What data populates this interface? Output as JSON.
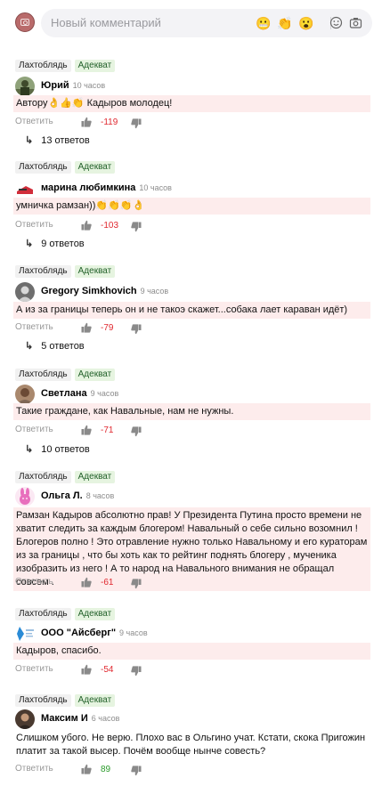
{
  "input": {
    "placeholder": "Новый комментарий",
    "emojis": [
      "😬",
      "👏",
      "😮"
    ]
  },
  "actions": {
    "reply_label": "Ответить"
  },
  "comments": [
    {
      "tag1": "Лахтоблядь",
      "tag2": "Адекват",
      "author": "Юрий",
      "time": "10 часов",
      "text": "Автору👌👍👏 Кадыров молодец!",
      "score": "-119",
      "replies": "13 ответов"
    },
    {
      "tag1": "Лахтоблядь",
      "tag2": "Адекват",
      "author": "марина любимкина",
      "time": "10 часов",
      "text": "умничка рамзан))👏👏👏👌",
      "score": "-103",
      "replies": "9 ответов"
    },
    {
      "tag1": "Лахтоблядь",
      "tag2": "Адекват",
      "author": "Gregory Simkhovich",
      "time": "9 часов",
      "text": "А из за границы теперь он и не такоэ скажет...собака лает караван идёт)",
      "score": "-79",
      "replies": "5 ответов"
    },
    {
      "tag1": "Лахтоблядь",
      "tag2": "Адекват",
      "author": "Светлана",
      "time": "9 часов",
      "text": "Такие граждане, как Навальные, нам не нужны.",
      "score": "-71",
      "replies": "10 ответов"
    },
    {
      "tag1": "Лахтоблядь",
      "tag2": "Адекват",
      "author": "Ольга Л.",
      "time": "8 часов",
      "text": "Рамзан Кадыров абсолютно прав! У Президента Путина просто времени не хватит следить за каждым блогером! Навальный о себе сильно возомнил ! Блогеров полно ! Это отравление нужно только Навальному и его кураторам из за границы , что бы хоть как то рейтинг поднять блогеру , мученика изобразить из него ! А то народ на Навального внимания не обращал совсем .",
      "score": "-61"
    },
    {
      "tag1": "Лахтоблядь",
      "tag2": "Адекват",
      "author": "ООО \"Айсберг\"",
      "time": "9 часов",
      "text": "Кадыров, спасибо.",
      "score": "-54"
    },
    {
      "tag1": "Лахтоблядь",
      "tag2": "Адекват",
      "author": "Максим И",
      "time": "6 часов",
      "text": "Слишком убого. Не верю. Плохо вас в Ольгино учат. Кстати, скока Пригожин платит за такой высер. Почём вообще нынче совесть?",
      "score": "89"
    }
  ],
  "colors": {
    "tag_green_bg": "#e6f4e0",
    "body_bg": "#fdecec",
    "negative": "#e0282f",
    "positive": "#2a9a2a"
  }
}
